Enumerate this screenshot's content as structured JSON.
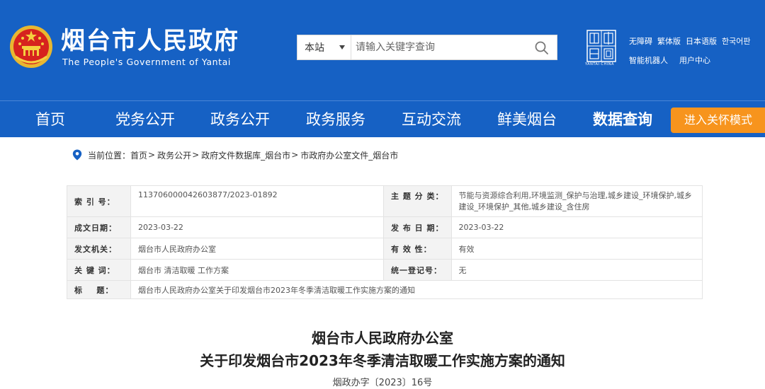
{
  "header": {
    "site_title": "烟台市人民政府",
    "site_subtitle": "The People's Government of Yantai",
    "bg_color": "#1661c4",
    "search": {
      "scope": "本站",
      "placeholder": "请输入关键字查询",
      "icon": "search-icon"
    },
    "seal_caption": "YANTAI·CHINA",
    "top_links_row1": [
      "无障碍",
      "繁体版",
      "日本语版",
      "한국어판"
    ],
    "top_links_row2": [
      "智能机器人",
      "用户中心"
    ]
  },
  "nav": {
    "items": [
      "首页",
      "党务公开",
      "政务公开",
      "政务服务",
      "互动交流",
      "鲜美烟台",
      "数据查询"
    ],
    "active": "数据查询",
    "care_mode_button": "进入关怀模式",
    "care_color": "#f7941d"
  },
  "breadcrumb": {
    "prefix": "当前位置：",
    "items": [
      "首页",
      "政务公开",
      "政府文件数据库_烟台市",
      "市政府办公室文件_烟台市"
    ],
    "separator": ">"
  },
  "meta": {
    "index_label": "索 引 号：",
    "index_value": "113706000042603877/2023-01892",
    "subject_label": "主 题 分 类：",
    "subject_value": "节能与资源综合利用,环境监测_保护与治理,城乡建设_环境保护,城乡建设_环境保护_其他,城乡建设_含住房",
    "date_label": "成文日期：",
    "date_value": "2023-03-22",
    "publish_label": "发 布 日 期：",
    "publish_value": "2023-03-22",
    "org_label": "发文机关：",
    "org_value": "烟台市人民政府办公室",
    "valid_label": "有 效 性：",
    "valid_value": "有效",
    "keywords_label": "关 键 词：",
    "keywords_value": "烟台市 清洁取暖 工作方案",
    "reg_label": "统一登记号：",
    "reg_value": "无",
    "title_label": "标    题：",
    "title_value": "烟台市人民政府办公室关于印发烟台市2023年冬季清洁取暖工作实施方案的通知"
  },
  "document": {
    "title_line1": "烟台市人民政府办公室",
    "title_line2": "关于印发烟台市2023年冬季清洁取暖工作实施方案的通知",
    "doc_number": "烟政办字〔2023〕16号"
  }
}
